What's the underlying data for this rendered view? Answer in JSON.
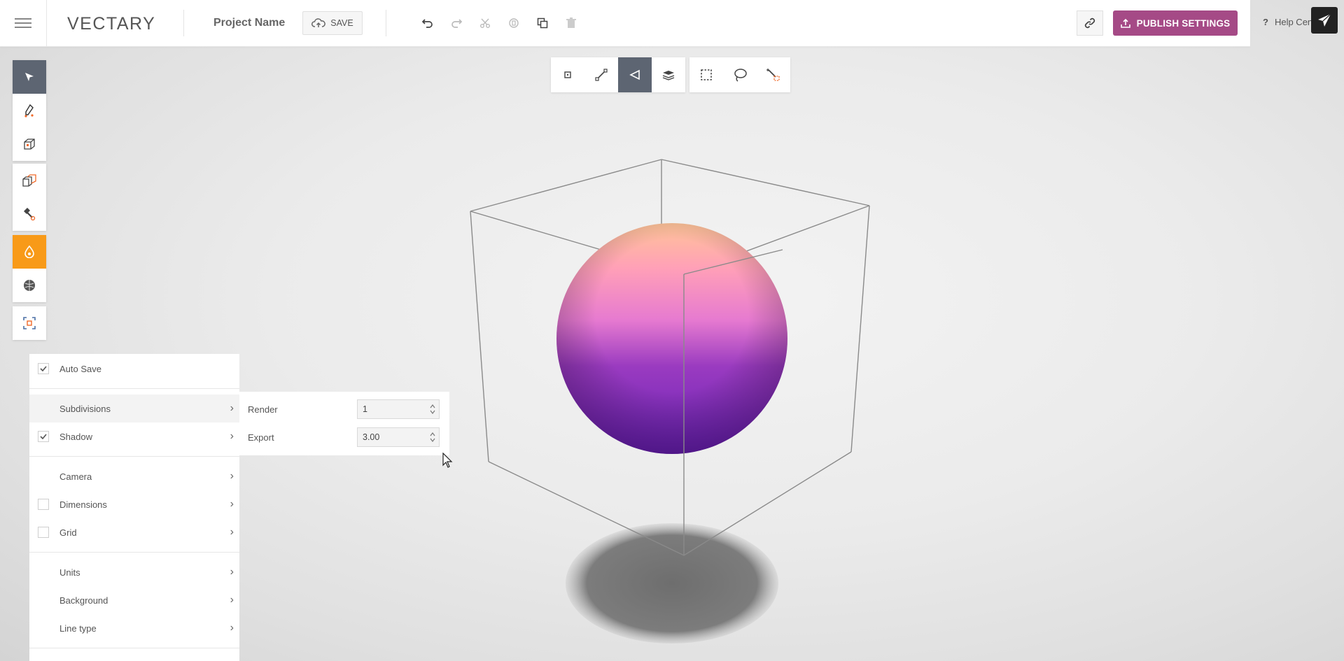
{
  "app": {
    "logo": "VECTARY",
    "project_name": "Project Name",
    "save_label": "SAVE"
  },
  "header": {
    "publish_label": "PUBLISH SETTINGS",
    "help_label": "Help Center"
  },
  "colors": {
    "accent": "#a54a86",
    "active_tool": "#5d6572",
    "material_tool": "#f89a18"
  },
  "edit_tools": [
    "undo-icon",
    "redo-icon",
    "cut-icon",
    "copy-icon",
    "duplicate-icon",
    "delete-icon"
  ],
  "left_toolbar": [
    "select-icon",
    "draw-icon",
    "primitive-icon",
    "modifier-icon",
    "hammer-icon",
    "material-icon",
    "environment-icon",
    "focus-icon"
  ],
  "selection_tools": [
    "vertex-icon",
    "edge-icon",
    "face-icon",
    "object-icon",
    "box-select-icon",
    "lasso-icon",
    "magic-select-icon"
  ],
  "settings": {
    "auto_save": {
      "label": "Auto Save",
      "checked": true
    },
    "subdivisions": {
      "label": "Subdivisions"
    },
    "shadow": {
      "label": "Shadow",
      "checked": true
    },
    "camera": {
      "label": "Camera"
    },
    "dimensions": {
      "label": "Dimensions",
      "checked": false
    },
    "grid": {
      "label": "Grid",
      "checked": false
    },
    "units": {
      "label": "Units"
    },
    "background": {
      "label": "Background"
    },
    "line_type": {
      "label": "Line type"
    }
  },
  "subdivisions_panel": {
    "render_label": "Render",
    "render_value": "1",
    "export_label": "Export",
    "export_value": "3.00"
  }
}
